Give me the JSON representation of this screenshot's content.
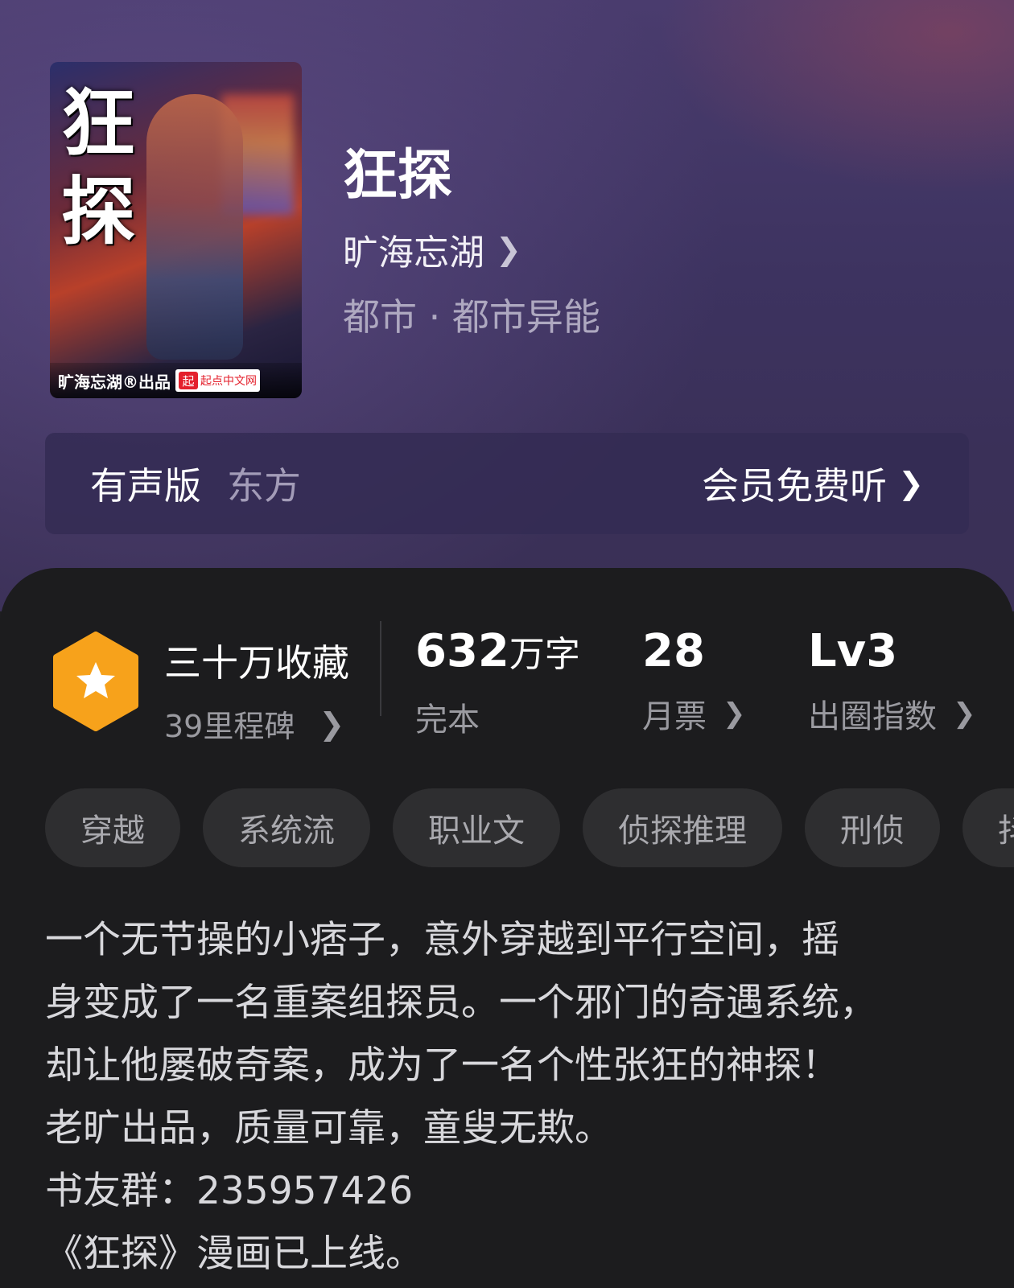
{
  "cover": {
    "title_chars": [
      "狂",
      "探"
    ],
    "credit": "旷海忘湖®出品",
    "brand_mark": "起",
    "brand_name": "起点中文网"
  },
  "book": {
    "title": "狂探",
    "author": "旷海忘湖",
    "genre": "都市 · 都市异能"
  },
  "audio": {
    "label": "有声版",
    "narrator": "东方",
    "cta": "会员免费听"
  },
  "stats": {
    "favorites": "三十万收藏",
    "milestones": "39里程碑",
    "word_count": "632",
    "word_unit": "万字",
    "status": "完本",
    "monthly_votes": "28",
    "monthly_votes_label": "月票",
    "level": "Lv3",
    "level_label": "出圈指数"
  },
  "tags": [
    "穿越",
    "系统流",
    "职业文",
    "侦探推理",
    "刑侦",
    "抖"
  ],
  "description": [
    "一个无节操的小痞子，意外穿越到平行空间，摇",
    "身变成了一名重案组探员。一个邪门的奇遇系统，",
    "却让他屡破奇案，成为了一名个性张狂的神探！",
    "老旷出品，质量可靠，童叟无欺。",
    "书友群：235957426",
    "《狂探》漫画已上线。"
  ],
  "colors": {
    "hero_top": "#4a3c6e",
    "panel_bg": "#1c1c1e",
    "badge_orange": "#f7a21b",
    "tag_bg": "#2e2e30"
  },
  "icons": {
    "badge": "hexagon-star-icon",
    "chevron": "chevron-right-icon"
  }
}
